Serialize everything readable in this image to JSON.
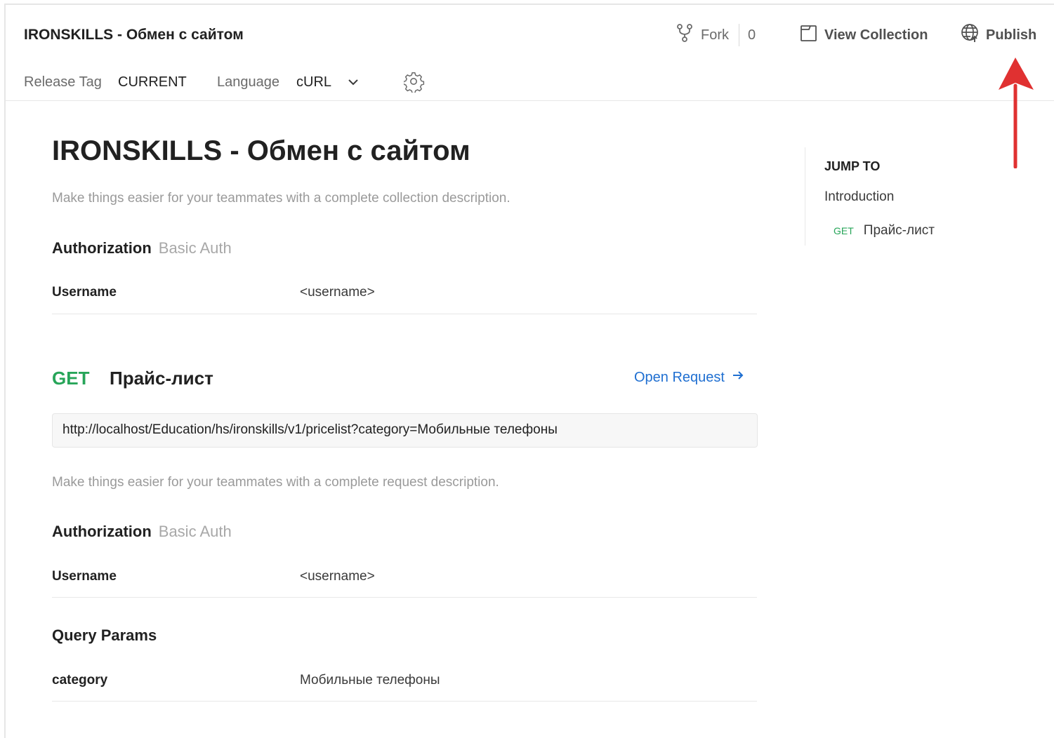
{
  "header": {
    "title": "IRONSKILLS - Обмен с сайтом",
    "fork_label": "Fork",
    "fork_count": "0",
    "view_collection_label": "View Collection",
    "publish_label": "Publish",
    "release_tag_label": "Release Tag",
    "release_tag_value": "CURRENT",
    "language_label": "Language",
    "language_value": "cURL"
  },
  "icons": {
    "fork": "fork-icon",
    "view_collection": "document-icon",
    "publish": "globe-icon",
    "language_dropdown": "chevron-down-icon",
    "settings": "gear-icon",
    "open_request": "arrow-right-icon"
  },
  "collection": {
    "title": "IRONSKILLS - Обмен с сайтом",
    "description": "Make things easier for your teammates with a complete collection description.",
    "auth_heading": "Authorization",
    "auth_type": "Basic Auth",
    "auth_rows": [
      {
        "key": "Username",
        "value": "<username>"
      }
    ]
  },
  "request": {
    "method": "GET",
    "name": "Прайс-лист",
    "open_request_label": "Open Request",
    "url": "http://localhost/Education/hs/ironskills/v1/pricelist?category=Мобильные телефоны",
    "description": "Make things easier for your teammates with a complete request description.",
    "auth_heading": "Authorization",
    "auth_type": "Basic Auth",
    "auth_rows": [
      {
        "key": "Username",
        "value": "<username>"
      }
    ],
    "query_heading": "Query Params",
    "query_rows": [
      {
        "key": "category",
        "value": "Мобильные телефоны"
      }
    ]
  },
  "jump_to": {
    "heading": "JUMP TO",
    "items": [
      {
        "label": "Introduction"
      },
      {
        "method": "GET",
        "label": "Прайс-лист"
      }
    ]
  },
  "colors": {
    "get_method": "#27a559",
    "link": "#1f6fd1",
    "annotation_arrow": "#e03131"
  }
}
